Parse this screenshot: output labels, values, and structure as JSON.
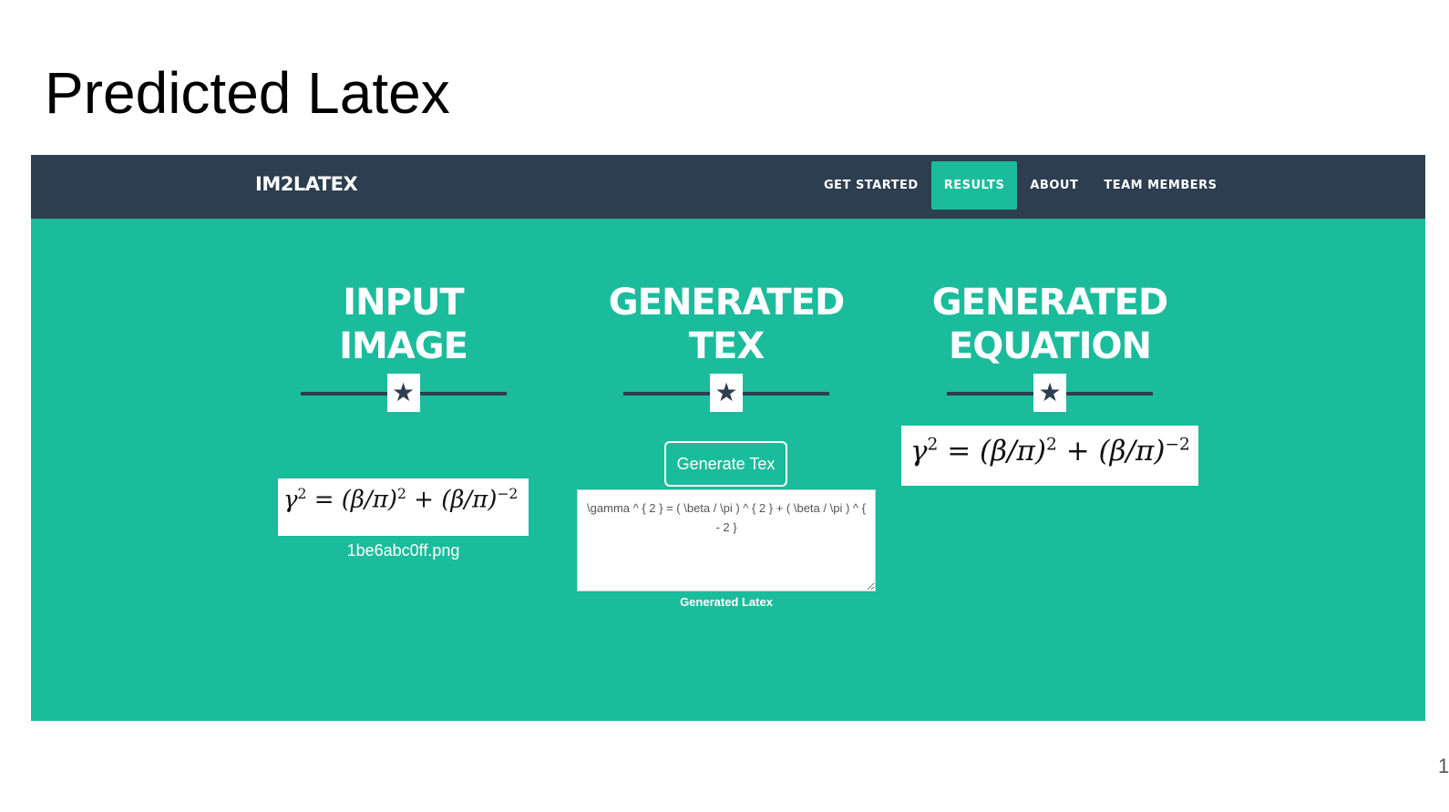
{
  "slide": {
    "title": "Predicted Latex",
    "page_number": "1"
  },
  "app": {
    "brand": "IM2LATEX",
    "nav": [
      {
        "label": "GET STARTED",
        "active": false
      },
      {
        "label": "RESULTS",
        "active": true
      },
      {
        "label": "ABOUT",
        "active": false
      },
      {
        "label": "TEAM MEMBERS",
        "active": false
      }
    ],
    "colors": {
      "navbar": "#2c3e50",
      "accent": "#1bbc9b",
      "text_on_accent": "#ffffff"
    }
  },
  "sections": {
    "input_image": {
      "heading": "INPUT IMAGE",
      "divider_icon": "star-icon",
      "equation_image_text": "γ² = (β/π)² + (β/π)⁻²",
      "filename": "1be6abc0ff.png"
    },
    "generated_tex": {
      "heading_line1": "GENERATED",
      "heading_line2": "TEX",
      "divider_icon": "star-icon",
      "button_label": "Generate Tex",
      "tex_output": "\\gamma ^ { 2 } = ( \\beta / \\pi ) ^ { 2 } + ( \\beta / \\pi ) ^ { - 2 }",
      "caption": "Generated Latex"
    },
    "generated_equation": {
      "heading_line1": "GENERATED",
      "heading_line2": "EQUATION",
      "divider_icon": "star-icon",
      "rendered_equation": "γ² = (β/π)² + (β/π)⁻²"
    }
  }
}
